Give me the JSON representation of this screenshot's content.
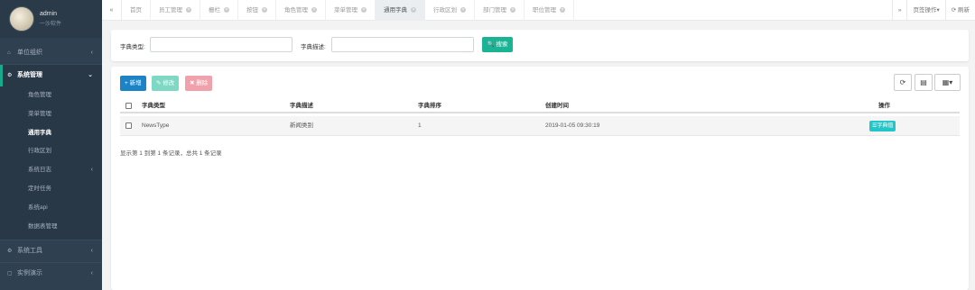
{
  "profile": {
    "name": "admin",
    "subtitle": "一沙软件"
  },
  "sidebar": {
    "items": [
      {
        "label": "单位组织",
        "icon": "home-icon",
        "glyph": "⌂",
        "arrow": "‹"
      },
      {
        "label": "系统管理",
        "icon": "gear-icon",
        "glyph": "⚙",
        "arrow": "⌄"
      },
      {
        "label": "系统工具",
        "icon": "gears-icon",
        "glyph": "⚙",
        "arrow": "‹"
      },
      {
        "label": "实例演示",
        "icon": "square-icon",
        "glyph": "▢",
        "arrow": "‹"
      }
    ],
    "submenu": [
      {
        "label": "角色管理"
      },
      {
        "label": "菜单管理"
      },
      {
        "label": "通用字典"
      },
      {
        "label": "行政区划"
      },
      {
        "label": "系统日志",
        "arrow": "‹"
      },
      {
        "label": "定时任务"
      },
      {
        "label": "系统api"
      },
      {
        "label": "数据表管理"
      }
    ]
  },
  "tabbar": {
    "back_glyph": "«",
    "forward_glyph": "»",
    "tabs": [
      {
        "label": "首页"
      },
      {
        "label": "员工管理"
      },
      {
        "label": "栅栏"
      },
      {
        "label": "按钮"
      },
      {
        "label": "角色管理"
      },
      {
        "label": "菜单管理"
      },
      {
        "label": "通用字典"
      },
      {
        "label": "行政区划"
      },
      {
        "label": "部门管理"
      },
      {
        "label": "职位管理"
      }
    ],
    "close_glyph": "×",
    "page_ops": "页签操作▾",
    "refresh": "⟳ 刷新"
  },
  "search": {
    "type_label": "字典类型:",
    "desc_label": "字典描述:",
    "type_value": "",
    "desc_value": "",
    "button": "🔍 搜索"
  },
  "toolbar": {
    "add": "+ 新增",
    "edit": "✎ 修改",
    "delete": "✖ 删除",
    "refresh_glyph": "⟳",
    "export_glyph": "▤",
    "columns_glyph": "▦▾"
  },
  "table": {
    "columns": [
      "字典类型",
      "字典描述",
      "字典排序",
      "创建时间",
      "操作"
    ],
    "rows": [
      {
        "type": "NewsType",
        "desc": "新闻类别",
        "sort": "1",
        "created": "2019-01-05 09:30:19",
        "action": "☰字典值"
      }
    ],
    "summary": "显示第 1 到第 1 条记录，总共 1 条记录"
  }
}
